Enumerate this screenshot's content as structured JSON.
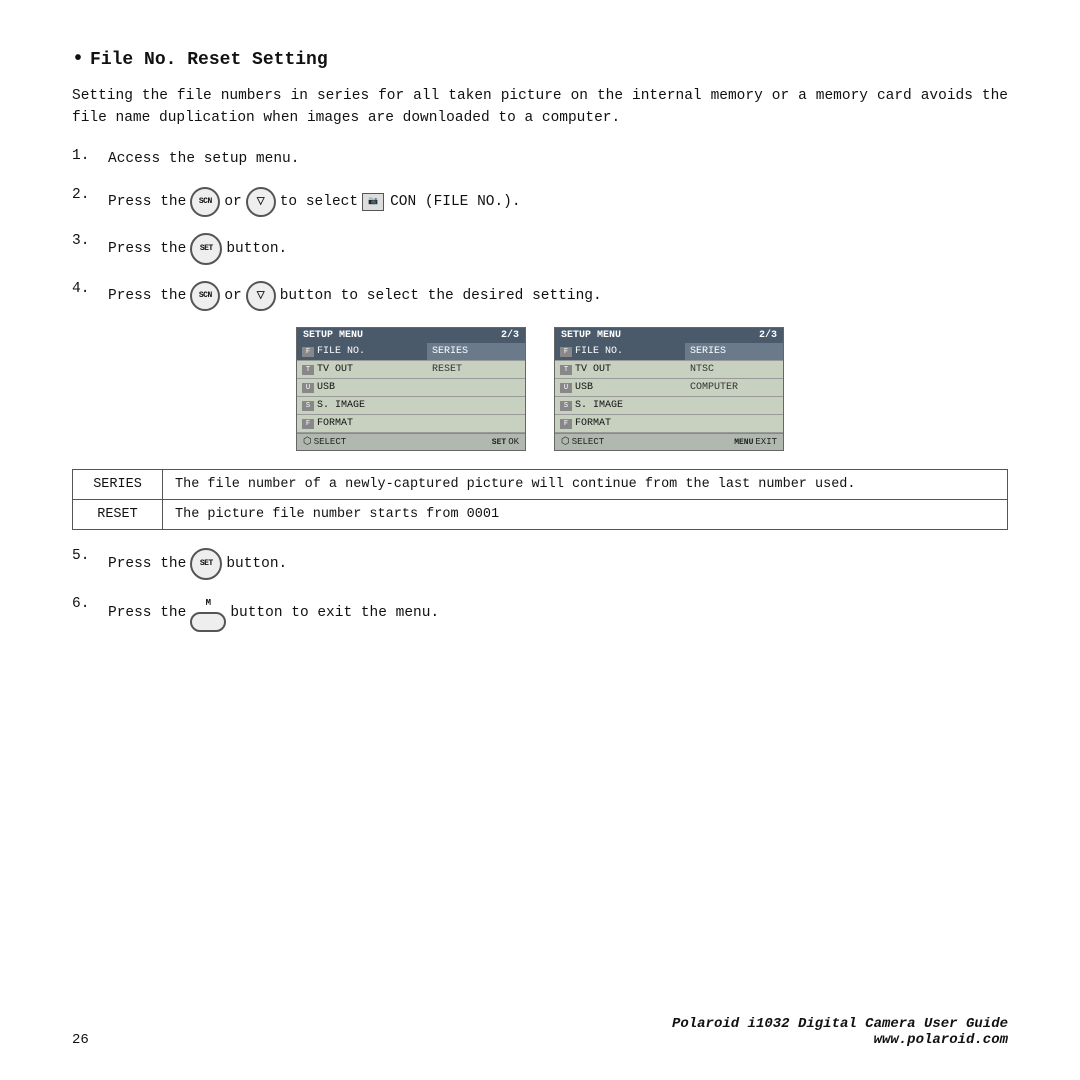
{
  "title": "File No. Reset Setting",
  "intro": "Setting the file numbers in series for all taken picture on the internal memory or a memory card avoids the file name duplication when images are downloaded to a computer.",
  "steps": [
    {
      "num": "1.",
      "text": "Access the setup menu."
    },
    {
      "num": "2.",
      "text_before": "Press the",
      "icon1": "SCN",
      "or": "or",
      "icon2": "▽",
      "text_after": "to select",
      "file_icon": "FILE",
      "text_end": "CON (FILE NO.)."
    },
    {
      "num": "3.",
      "text_before": "Press the",
      "icon": "SET",
      "text_after": "button."
    },
    {
      "num": "4.",
      "text_before": "Press the",
      "icon1": "SCN",
      "or": "or",
      "icon2": "▽",
      "text_after": "button to select the desired setting."
    },
    {
      "num": "5.",
      "text_before": "Press the",
      "icon": "SET",
      "text_after": "button."
    },
    {
      "num": "6.",
      "text_before": "Press the",
      "icon": "M",
      "menu_label": "menu",
      "text_after": "button to exit the menu."
    }
  ],
  "screen_left": {
    "header_left": "SETUP MENU",
    "header_right": "2/3",
    "rows": [
      {
        "icon": "F",
        "label": "FILE NO.",
        "value": "SERIES",
        "highlighted": true
      },
      {
        "icon": "T",
        "label": "TV OUT",
        "value": "RESET",
        "highlighted": false
      },
      {
        "icon": "U",
        "label": "USB",
        "value": "",
        "highlighted": false
      },
      {
        "icon": "S",
        "label": "S. IMAGE",
        "value": "",
        "highlighted": false
      },
      {
        "icon": "Fm",
        "label": "FORMAT",
        "value": "",
        "highlighted": false
      }
    ],
    "footer_left": "SELECT",
    "footer_right": "OK"
  },
  "screen_right": {
    "header_left": "SETUP MENU",
    "header_right": "2/3",
    "rows": [
      {
        "icon": "F",
        "label": "FILE NO.",
        "value": "SERIES",
        "highlighted": true
      },
      {
        "icon": "T",
        "label": "TV OUT",
        "value": "NTSC",
        "highlighted": false
      },
      {
        "icon": "U",
        "label": "USB",
        "value": "COMPUTER",
        "highlighted": false
      },
      {
        "icon": "S",
        "label": "S. IMAGE",
        "value": "",
        "highlighted": false
      },
      {
        "icon": "Fm",
        "label": "FORMAT",
        "value": "",
        "highlighted": false
      }
    ],
    "footer_left": "SELECT",
    "footer_right": "EXIT"
  },
  "table": {
    "rows": [
      {
        "label": "SERIES",
        "description": "The file number of a newly-captured picture will continue from the last number used."
      },
      {
        "label": "RESET",
        "description": "The picture file number starts from 0001"
      }
    ]
  },
  "footer": {
    "page": "26",
    "brand": "Polaroid i1032 Digital Camera User Guide",
    "url": "www.polaroid.com"
  }
}
